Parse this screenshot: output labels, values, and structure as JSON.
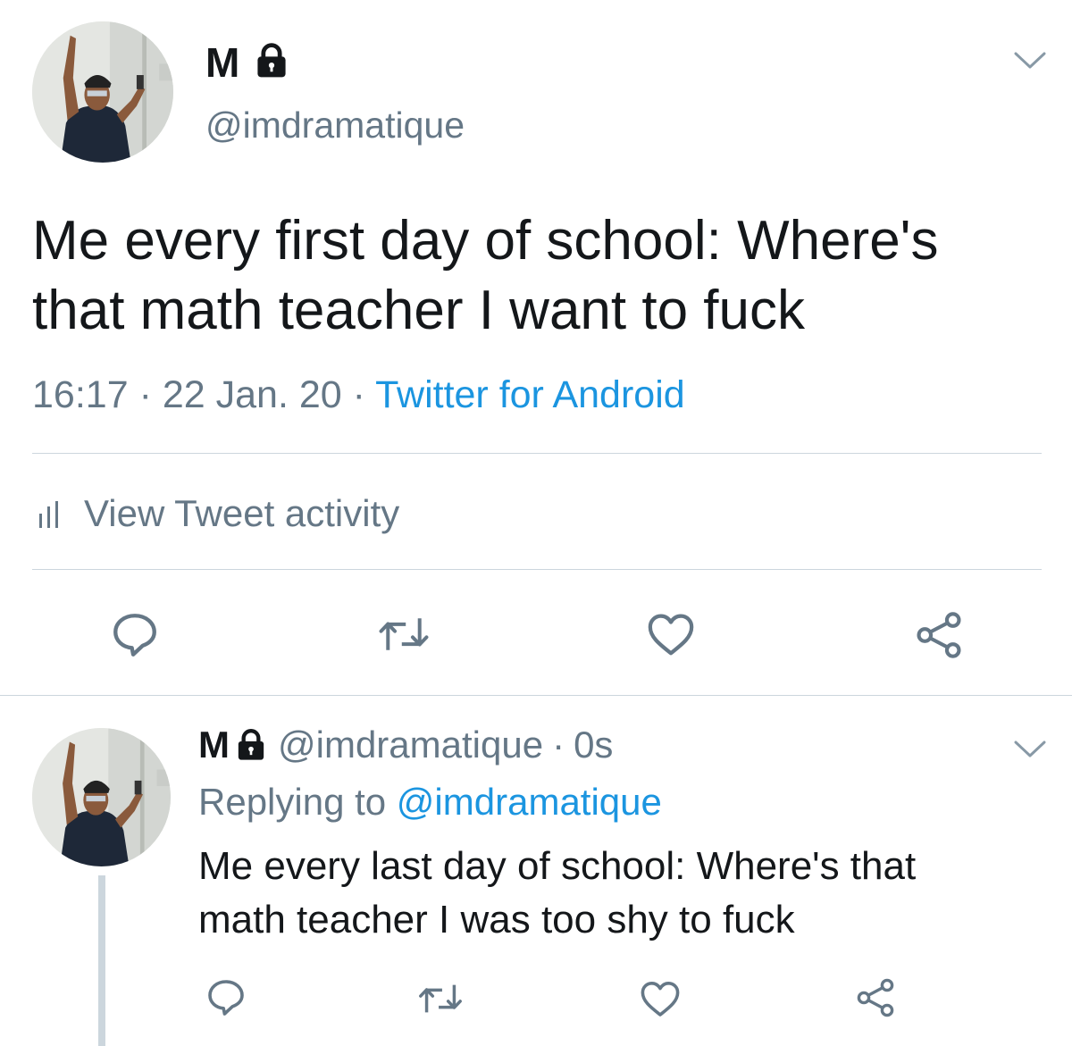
{
  "main_tweet": {
    "display_name": "M",
    "handle": "@imdramatique",
    "text_lines": [
      "Me every first day of school: Where's",
      "that math teacher I want to fuck"
    ],
    "time": "16:17",
    "separator": "·",
    "date": "22 Jan. 20",
    "source": "Twitter for Android",
    "activity_label": "View Tweet activity"
  },
  "reply_tweet": {
    "display_name": "M",
    "handle": "@imdramatique",
    "separator": "·",
    "time": "0s",
    "replying_prefix": "Replying to ",
    "replying_handle": "@imdramatique",
    "text_lines": [
      "Me every last day of school: Where's that",
      "math teacher I was too shy to fuck"
    ]
  },
  "icons": {
    "lock": "lock-icon",
    "chevron": "chevron-down-icon",
    "activity": "bar-chart-icon",
    "reply": "reply-bubble-icon",
    "retweet": "retweet-icon",
    "like": "heart-icon",
    "share": "share-icon"
  },
  "colors": {
    "text": "#14171a",
    "secondary": "#657786",
    "link": "#1b95e0",
    "divider": "#ccd6dd",
    "background": "#ffffff"
  }
}
